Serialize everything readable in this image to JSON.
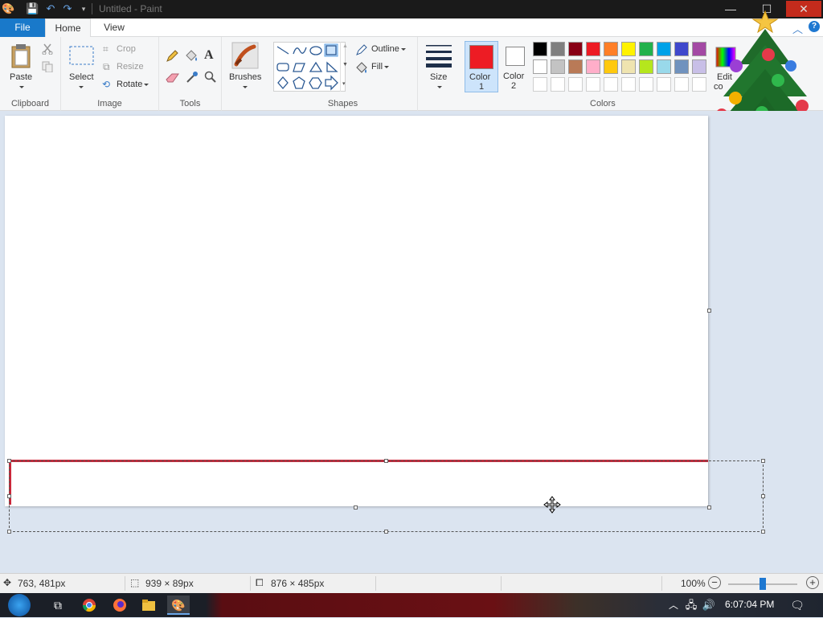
{
  "window": {
    "title": "Untitled - Paint",
    "minimize": "—",
    "maximize": "☐",
    "close": "✕"
  },
  "tabs": {
    "file": "File",
    "home": "Home",
    "view": "View"
  },
  "clipboard": {
    "paste": "Paste",
    "group": "Clipboard"
  },
  "image": {
    "select": "Select",
    "crop": "Crop",
    "resize": "Resize",
    "rotate": "Rotate",
    "group": "Image"
  },
  "tools": {
    "group": "Tools"
  },
  "brushes": {
    "label": "Brushes"
  },
  "shapes": {
    "outline": "Outline",
    "fill": "Fill",
    "group": "Shapes"
  },
  "size": {
    "label": "Size"
  },
  "color1": {
    "line1": "Color",
    "line2": "1",
    "value": "#ed1c24"
  },
  "color2": {
    "line1": "Color",
    "line2": "2",
    "value": "#ffffff"
  },
  "colors": {
    "group": "Colors",
    "edit_line1": "Edit",
    "edit_line2": "co",
    "row1": [
      "#000000",
      "#7f7f7f",
      "#880015",
      "#ed1c24",
      "#ff7f27",
      "#fff200",
      "#22b14c",
      "#00a2e8",
      "#3f48cc",
      "#a349a4"
    ],
    "row2": [
      "#ffffff",
      "#c3c3c3",
      "#b97a57",
      "#ffaec9",
      "#ffc90e",
      "#efe4b0",
      "#b5e61d",
      "#99d9ea",
      "#7092be",
      "#c8bfe7"
    ]
  },
  "status": {
    "cursor": "763, 481px",
    "selection": "939 × 89px",
    "image_size": "876 × 485px",
    "zoom": "100%",
    "zoom_level": 100
  },
  "taskbar": {
    "time": "6:07:04 PM"
  }
}
